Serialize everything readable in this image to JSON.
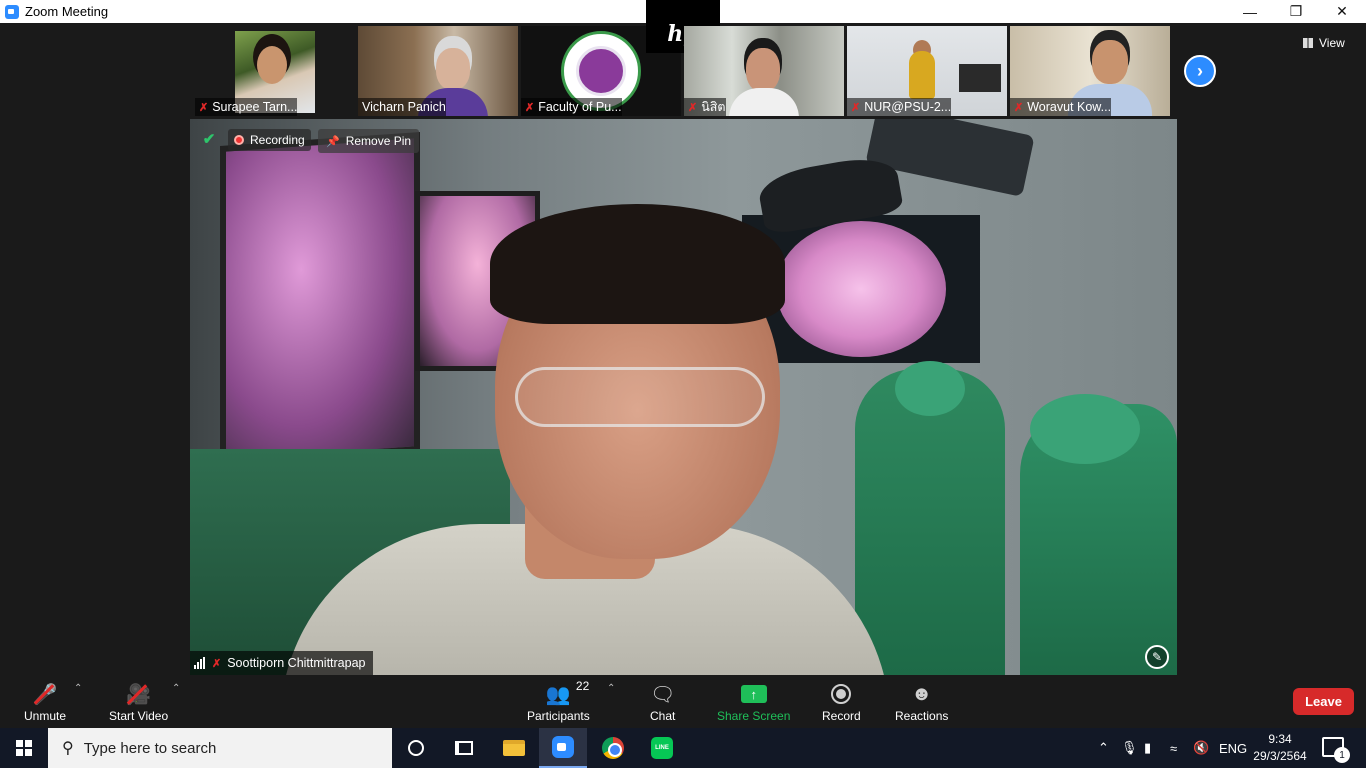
{
  "window": {
    "title": "Zoom Meeting",
    "minimize_icon": "minimize-icon",
    "maximize_icon": "restore-icon",
    "close_icon": "close-icon"
  },
  "thumbnails": [
    {
      "name": "Surapee Tarn...",
      "muted": true
    },
    {
      "name": "Vicharn Panich",
      "muted": false
    },
    {
      "name": "Faculty of Pu...",
      "muted": true
    },
    {
      "name": "นิสิต",
      "muted": true
    },
    {
      "name": "NUR@PSU-2...",
      "muted": true
    },
    {
      "name": "Woravut Kow...",
      "muted": true
    }
  ],
  "overlay_logo": "hp",
  "view_button": {
    "label": "View"
  },
  "main_video": {
    "recording_label": "Recording",
    "remove_pin_label": "Remove Pin",
    "speaker_name": "Soottiporn Chittmittrapap",
    "speaker_muted": true
  },
  "toolbar": {
    "unmute_label": "Unmute",
    "start_video_label": "Start Video",
    "participants_label": "Participants",
    "participants_count": "22",
    "chat_label": "Chat",
    "share_screen_label": "Share Screen",
    "record_label": "Record",
    "reactions_label": "Reactions",
    "leave_label": "Leave"
  },
  "taskbar": {
    "search_placeholder": "Type here to search",
    "language": "ENG",
    "time": "9:34",
    "date": "29/3/2564",
    "notification_count": "1"
  },
  "colors": {
    "zoom_blue": "#2d8cff",
    "share_green": "#1fbf59",
    "leave_red": "#d72a2a",
    "muted_red": "#e02828"
  }
}
